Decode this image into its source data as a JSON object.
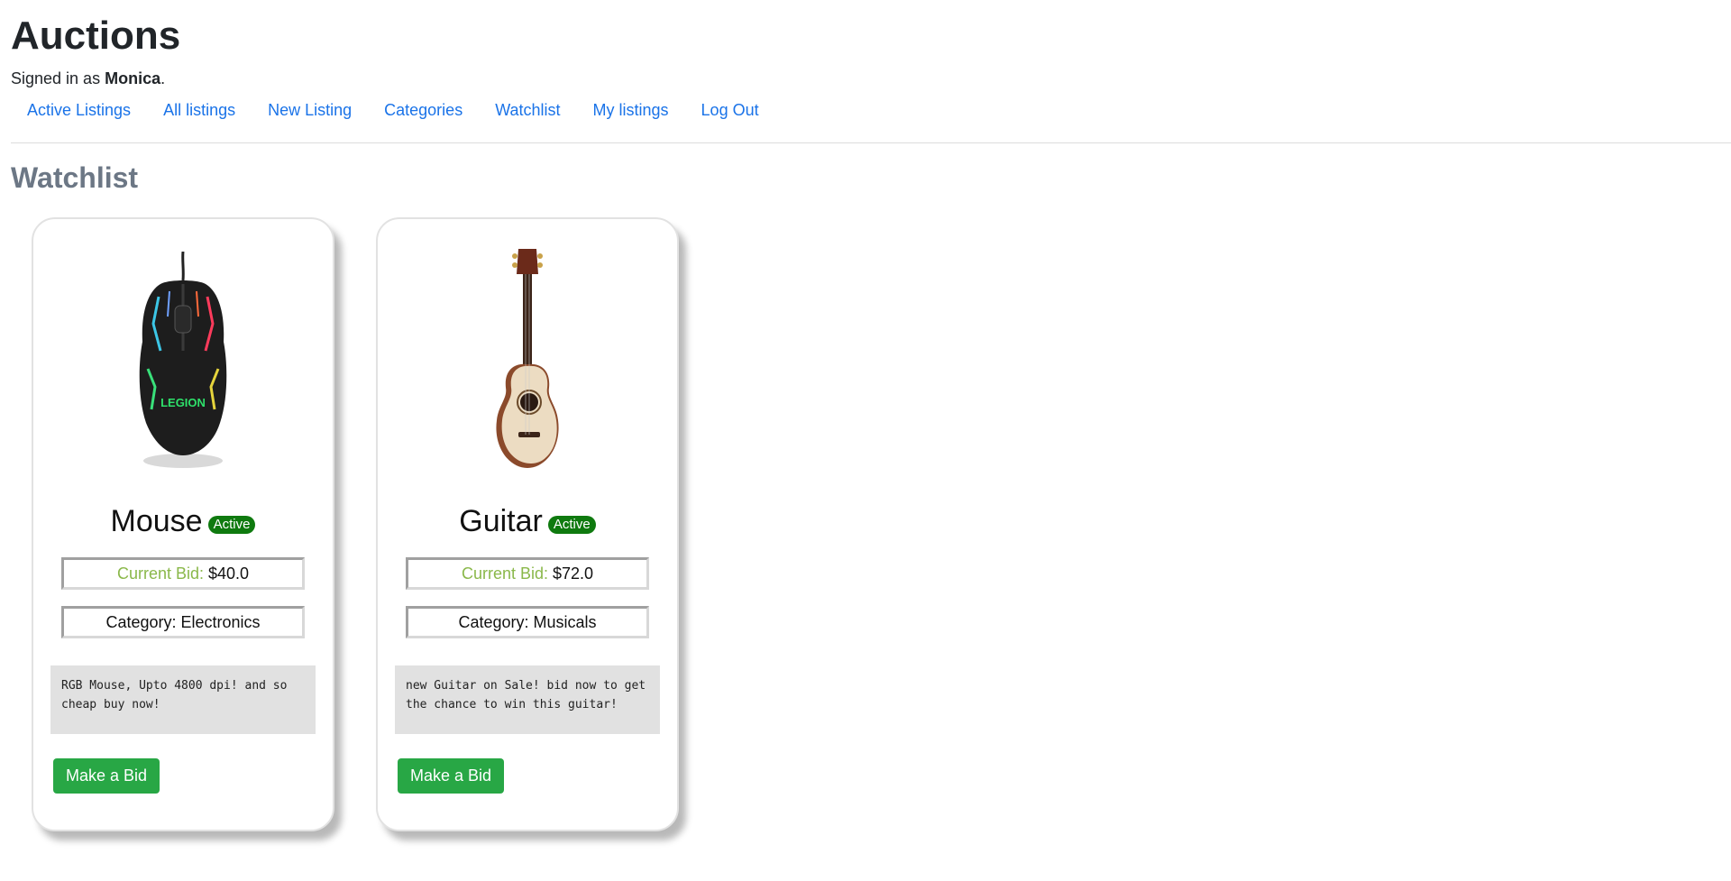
{
  "app": {
    "title": "Auctions"
  },
  "signed_in": {
    "prefix": "Signed in as ",
    "user": "Monica",
    "suffix": "."
  },
  "nav": {
    "items": [
      {
        "label": "Active Listings"
      },
      {
        "label": "All listings"
      },
      {
        "label": "New Listing"
      },
      {
        "label": "Categories"
      },
      {
        "label": "Watchlist"
      },
      {
        "label": "My listings"
      },
      {
        "label": "Log Out"
      }
    ]
  },
  "page": {
    "heading": "Watchlist"
  },
  "listings": [
    {
      "title": "Mouse",
      "status": "Active",
      "bid_label": "Current Bid:",
      "bid_value": "$40.0",
      "category": "Category: Electronics",
      "description": "RGB Mouse, Upto 4800 dpi! and so cheap buy now!",
      "button": "Make a Bid",
      "image_icon": "gaming-mouse-image"
    },
    {
      "title": "Guitar",
      "status": "Active",
      "bid_label": "Current Bid:",
      "bid_value": "$72.0",
      "category": "Category: Musicals",
      "description": "new Guitar on Sale! bid now to get the chance to win this guitar!",
      "button": "Make a Bid",
      "image_icon": "acoustic-guitar-image"
    }
  ],
  "colors": {
    "link": "#1a73e8",
    "badge": "#0f7a0f",
    "button": "#28a745",
    "bid_label": "#8ab84a",
    "heading": "#6c7785"
  }
}
